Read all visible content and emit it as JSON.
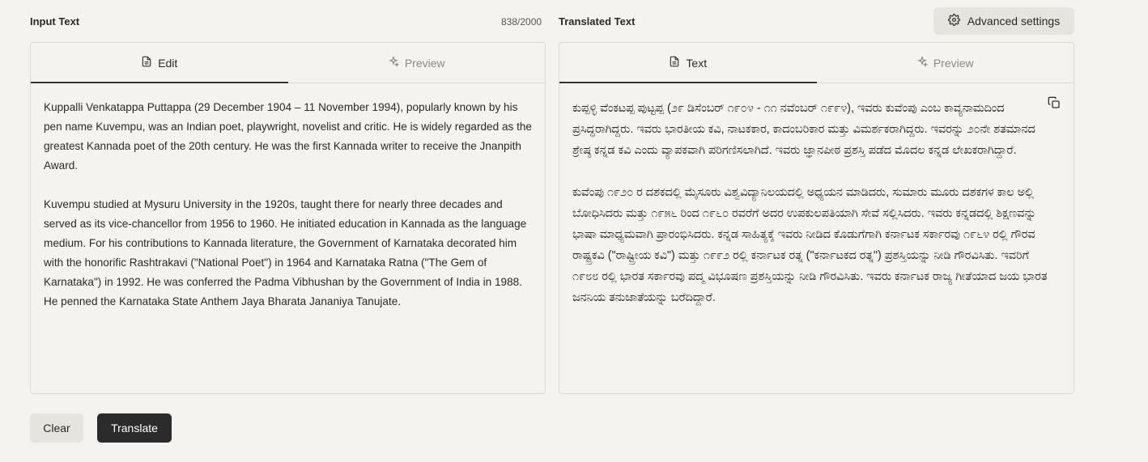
{
  "input": {
    "title": "Input Text",
    "counter": "838/2000",
    "tabs": {
      "edit": "Edit",
      "preview": "Preview"
    },
    "paragraphs": [
      "Kuppalli Venkatappa Puttappa (29 December 1904 – 11 November 1994), popularly known by his pen name Kuvempu, was an Indian poet, playwright, novelist and critic. He is widely regarded as the greatest Kannada poet of the 20th century. He was the first Kannada writer to receive the Jnanpith Award.",
      "Kuvempu studied at Mysuru University in the 1920s, taught there for nearly three decades and served as its vice-chancellor from 1956 to 1960. He initiated education in Kannada as the language medium. For his contributions to Kannada literature, the Government of Karnataka decorated him with the honorific Rashtrakavi (\"National Poet\") in 1964 and Karnataka Ratna (\"The Gem of Karnataka\") in 1992. He was conferred the Padma Vibhushan by the Government of India in 1988. He penned the Karnataka State Anthem Jaya Bharata Jananiya Tanujate."
    ]
  },
  "output": {
    "title": "Translated Text",
    "tabs": {
      "text": "Text",
      "preview": "Preview"
    },
    "paragraphs": [
      "ಕುಪ್ಪಳ್ಳಿ ವೆಂಕಟಪ್ಪ ಪುಟ್ಟಪ್ಪ (೨೯ ಡಿಸೆಂಬರ್ ೧೯೦೪ - ೧೧ ನವೆಂಬರ್ ೧೯೯೪), ಇವರು ಕುವೆಂಪು ಎಂಬ ಕಾವ್ಯನಾಮದಿಂದ ಪ್ರಸಿದ್ಧರಾಗಿದ್ದರು. ಇವರು ಭಾರತೀಯ ಕವಿ, ನಾಟಕಕಾರ, ಕಾದಂಬರಿಕಾರ ಮತ್ತು ವಿಮರ್ಶಕರಾಗಿದ್ದರು. ಇವರನ್ನು ೨೦ನೇ ಶತಮಾನದ ಶ್ರೇಷ್ಠ ಕನ್ನಡ ಕವಿ ಎಂದು ವ್ಯಾಪಕವಾಗಿ ಪರಿಗಣಿಸಲಾಗಿದೆ. ಇವರು ಜ್ಞಾನಪೀಠ ಪ್ರಶಸ್ತಿ ಪಡೆದ ಮೊದಲ ಕನ್ನಡ ಲೇಖಕರಾಗಿದ್ದಾರೆ.",
      "ಕುವೆಂಪು ೧೯೨೦ ರ ದಶಕದಲ್ಲಿ ಮೈಸೂರು ವಿಶ್ವವಿದ್ಯಾನಿಲಯದಲ್ಲಿ ಅಧ್ಯಯನ ಮಾಡಿದರು, ಸುಮಾರು ಮೂರು ದಶಕಗಳ ಕಾಲ ಅಲ್ಲಿ ಬೋಧಿಸಿದರು ಮತ್ತು ೧೯೫೬ ರಿಂದ ೧೯೬೦ ರವರೆಗೆ ಅದರ ಉಪಕುಲಪತಿಯಾಗಿ ಸೇವೆ ಸಲ್ಲಿಸಿದರು. ಇವರು ಕನ್ನಡದಲ್ಲಿ ಶಿಕ್ಷಣವನ್ನು ಭಾಷಾ ಮಾಧ್ಯಮವಾಗಿ ಪ್ರಾರಂಭಿಸಿದರು. ಕನ್ನಡ ಸಾಹಿತ್ಯಕ್ಕೆ ಇವರು ನೀಡಿದ ಕೊಡುಗೆಗಾಗಿ ಕರ್ನಾಟಕ ಸರ್ಕಾರವು ೧೯೬೪ ರಲ್ಲಿ ಗೌರವ ರಾಷ್ಟ್ರಕವಿ (\"ರಾಷ್ಟ್ರೀಯ ಕವಿ\") ಮತ್ತು ೧೯೯೨ ರಲ್ಲಿ ಕರ್ನಾಟಕ ರತ್ನ (\"ಕರ್ನಾಟಕದ ರತ್ನ\") ಪ್ರಶಸ್ತಿಯನ್ನು ನೀಡಿ ಗೌರವಿಸಿತು. ಇವರಿಗೆ ೧೯೮೮ ರಲ್ಲಿ ಭಾರತ ಸರ್ಕಾರವು ಪದ್ಮ ವಿಭೂಷಣ ಪ್ರಶಸ್ತಿಯನ್ನು ನೀಡಿ ಗೌರವಿಸಿತು. ಇವರು ಕರ್ನಾಟಕ ರಾಜ್ಯ ಗೀತೆಯಾದ ಜಯ ಭಾರತ ಜನನಿಯ ತನುಜಾತೆಯನ್ನು ಬರೆದಿದ್ದಾರೆ."
    ]
  },
  "actions": {
    "advanced_settings": "Advanced settings",
    "clear": "Clear",
    "translate": "Translate"
  },
  "icons": {
    "edit": "document-icon",
    "preview": "sparkle-icon",
    "settings": "gear-icon",
    "copy": "copy-icon"
  }
}
